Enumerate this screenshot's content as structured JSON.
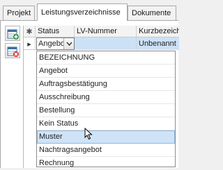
{
  "tabs": [
    {
      "label": "Projekt"
    },
    {
      "label": "Leistungsverzeichnisse",
      "active": true
    },
    {
      "label": "Dokumente"
    }
  ],
  "toolbar": {
    "buttons": [
      {
        "icon": "add-row-icon"
      },
      {
        "icon": "delete-row-icon"
      }
    ]
  },
  "grid": {
    "marker_symbol": "✱",
    "columns": [
      "Status",
      "LV-Nummer",
      "Kurzbezeichnung"
    ],
    "row": {
      "indicator": "▸",
      "status": "Angebot",
      "lv_nummer": "",
      "kurzbezeichnung": "Unbenannt"
    }
  },
  "dropdown": {
    "header": "BEZEICHNUNG",
    "options": [
      "Angebot",
      "Auftragsbestätigung",
      "Ausschreibung",
      "Bestellung",
      "Kein Status",
      "Muster",
      "Nachtragsangebot",
      "Rechnung"
    ],
    "hovered": "Muster"
  },
  "colors": {
    "hover_bg": "#cfe3f7",
    "border": "#a8a8a8"
  }
}
